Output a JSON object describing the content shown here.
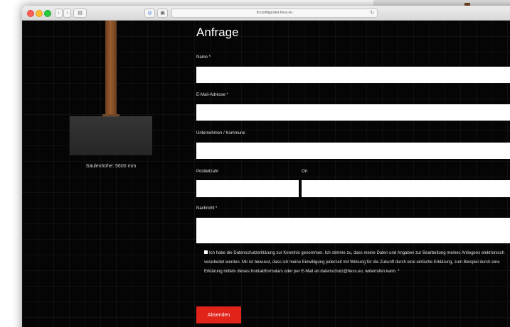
{
  "browser": {
    "url": "ib.configurator.hess.eu",
    "back_glyph": "‹",
    "forward_glyph": "›",
    "sidebar_glyph": "▤",
    "shield_glyph": "◎",
    "reader_glyph": "▣",
    "reload_glyph": "↻"
  },
  "preview": {
    "column_height_label": "Säulenhöhe: 5600 mm"
  },
  "form": {
    "title": "Anfrage",
    "name_label": "Name *",
    "email_label": "E-Mail-Adresse *",
    "company_label": "Unternehmen / Kommune",
    "zip_label": "Postleitzahl",
    "city_label": "Ort",
    "message_label": "Nachricht *",
    "name_value": "",
    "email_value": "",
    "company_value": "",
    "zip_value": "",
    "city_value": "",
    "message_value": "",
    "consent_text": "Ich habe die Datenschutzerklärung zur Kenntnis genommen. Ich stimme zu, dass meine Daten und Angaben zur Bearbeitung meines Anliegens elektronisch verarbeitet werden. Mir ist bewusst, dass ich meine Einwilligung jederzeit mit Wirkung für die Zukunft durch eine einfache Erklärung, zum Beispiel durch eine Erklärung mittels dieses Kontaktformulars oder per E-Mail an datenschutz@hess.eu, widerrufen kann. *",
    "submit_label": "Absenden"
  },
  "colors": {
    "accent_red": "#e2231a",
    "page_background": "#050505",
    "pole_brown": "#9a5c31"
  }
}
